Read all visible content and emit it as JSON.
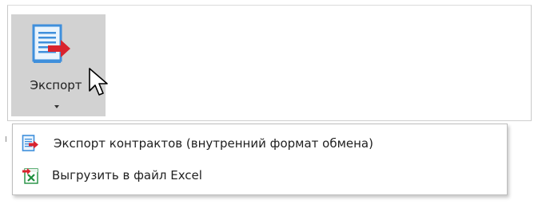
{
  "ribbon": {
    "export_button": {
      "label": "Экспорт",
      "icon": "document-export-icon"
    }
  },
  "export_menu": {
    "items": [
      {
        "label": "Экспорт контрактов (внутренний формат обмена)",
        "icon": "document-export-icon"
      },
      {
        "label": "Выгрузить в файл Excel",
        "icon": "excel-export-icon"
      }
    ]
  },
  "colors": {
    "button_pressed_bg": "#d2d2d2",
    "document_blue": "#3f8fdc",
    "arrow_red": "#d9232e",
    "excel_green": "#1e8f3e"
  }
}
